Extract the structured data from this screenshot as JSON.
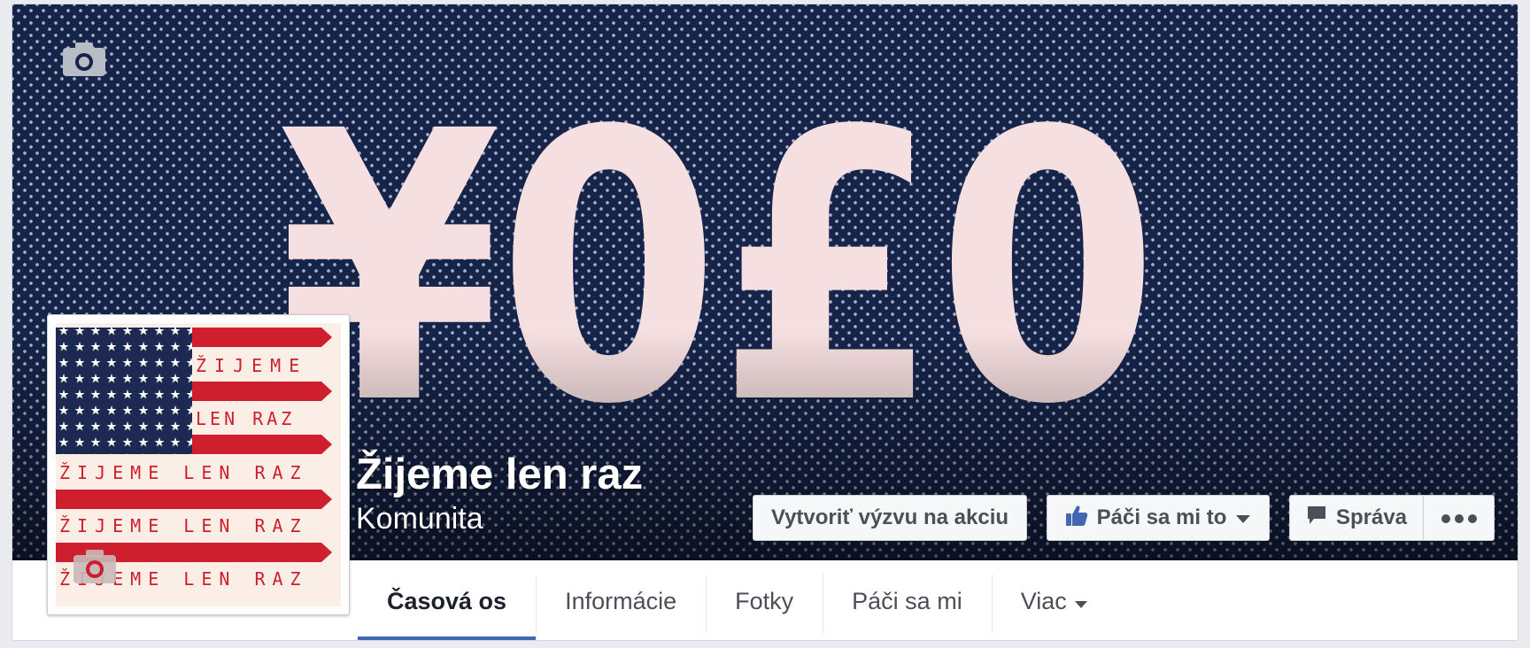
{
  "cover": {
    "headline": "¥0£0",
    "icon": "camera-icon"
  },
  "profile": {
    "name": "Žijeme len raz",
    "category": "Komunita",
    "avatar_text_1": "ŽIJEME",
    "avatar_text_2": "LEN RAZ",
    "avatar_text_3": "ŽIJEME LEN RAZ",
    "avatar_icon": "camera-icon",
    "colors": {
      "red": "#cf1f2e",
      "blue": "#1c2a52",
      "cream": "#fbeee6"
    }
  },
  "actions": {
    "event_label": "Vytvoriť výzvu na akciu",
    "like_label": "Páči sa mi to",
    "like_icon": "thumbs-up-icon",
    "message_label": "Správa",
    "message_icon": "speech-bubble-icon",
    "more_icon": "ellipsis-icon"
  },
  "tabs": [
    {
      "label": "Časová os",
      "active": true
    },
    {
      "label": "Informácie"
    },
    {
      "label": "Fotky"
    },
    {
      "label": "Páči sa mi"
    },
    {
      "label": "Viac",
      "icon": "chevron-down-icon"
    }
  ],
  "colors": {
    "cover_bg": "#16244a",
    "accent": "#4267b2",
    "headline": "#f6dfe0"
  }
}
